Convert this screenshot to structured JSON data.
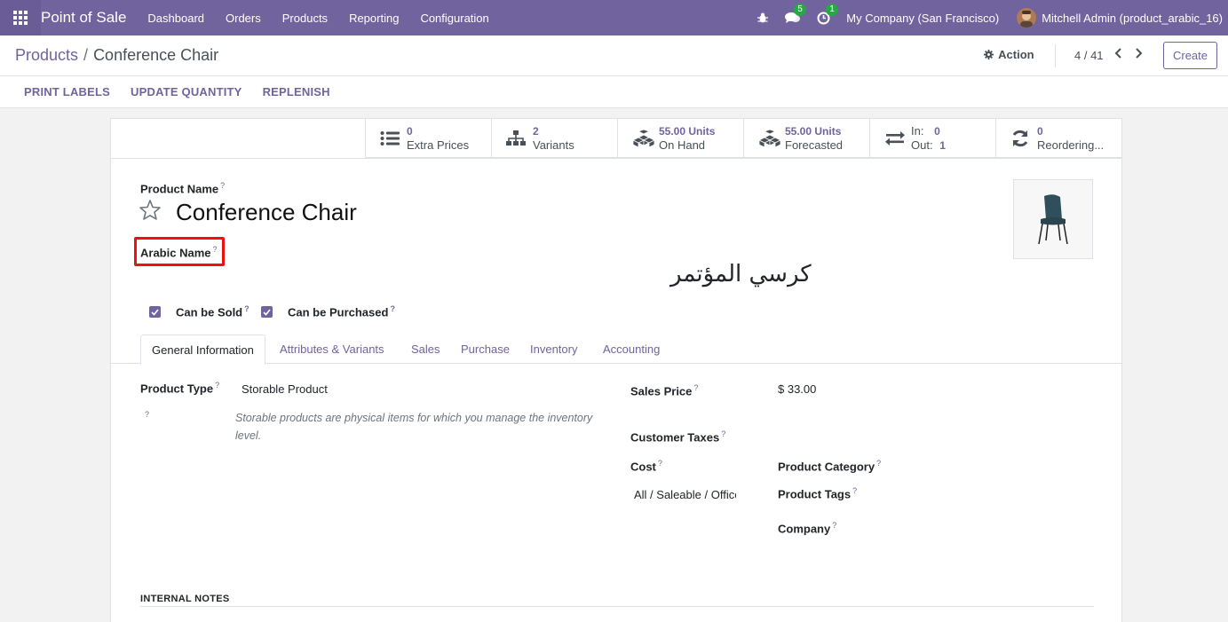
{
  "navbar": {
    "app_name": "Point of Sale",
    "menu": [
      "Dashboard",
      "Orders",
      "Products",
      "Reporting",
      "Configuration"
    ],
    "messages_count": "5",
    "activities_count": "1",
    "company": "My Company (San Francisco)",
    "user": "Mitchell Admin (product_arabic_16)"
  },
  "control_panel": {
    "breadcrumb_parent": "Products",
    "breadcrumb_sep": "/",
    "breadcrumb_current": "Conference Chair",
    "action_label": "Action",
    "pager": "4 / 41",
    "create_label": "Create",
    "status_buttons": [
      "PRINT LABELS",
      "UPDATE QUANTITY",
      "REPLENISH"
    ]
  },
  "smart_buttons": [
    {
      "value": "0",
      "label": "Extra Prices",
      "icon": "list-icon"
    },
    {
      "value": "2",
      "label": "Variants",
      "icon": "sitemap-icon"
    },
    {
      "value": "55.00 Units",
      "label": "On Hand",
      "icon": "cubes-icon"
    },
    {
      "value": "55.00 Units",
      "label": "Forecasted",
      "icon": "cubes-icon"
    },
    {
      "in_label": "In:",
      "in_value": "0",
      "out_label": "Out:",
      "out_value": "1",
      "icon": "exchange-icon"
    },
    {
      "value": "0",
      "label": "Reordering...",
      "icon": "refresh-icon"
    }
  ],
  "form": {
    "product_name_label": "Product Name",
    "product_name": "Conference Chair",
    "arabic_name_label": "Arabic Name",
    "arabic_name": "كرسي المؤتمر",
    "can_be_sold": "Can be Sold",
    "can_be_purchased": "Can be Purchased",
    "help_mark": "?"
  },
  "tabs": [
    "General Information",
    "Attributes & Variants",
    "Sales",
    "Purchase",
    "Inventory",
    "Accounting"
  ],
  "general": {
    "product_type_label": "Product Type",
    "product_type": "Storable Product",
    "product_type_hint": "Storable products are physical items for which you manage the inventory level.",
    "sales_price_label": "Sales Price",
    "sales_price": "$ 33.00",
    "customer_taxes_label": "Customer Taxes",
    "cost_label": "Cost",
    "product_category_label": "Product Category",
    "product_category": "All / Saleable / Office Furniture",
    "product_tags_label": "Product Tags",
    "company_label": "Company",
    "internal_notes_label": "INTERNAL NOTES"
  },
  "colors": {
    "brand": "#71639e",
    "highlight": "#ee1111",
    "badge": "#28a745"
  }
}
